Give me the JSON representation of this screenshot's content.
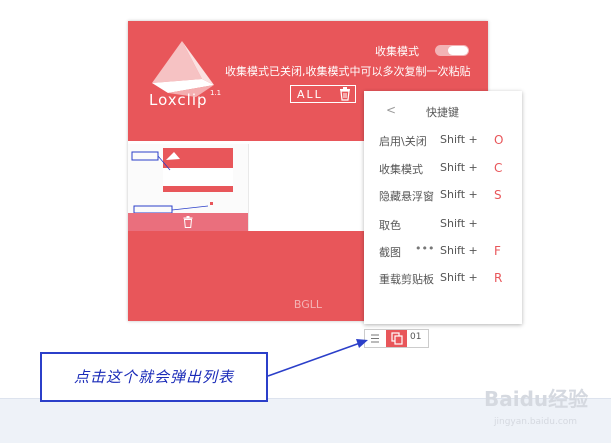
{
  "app": {
    "name": "Loxclip",
    "version": "1.1",
    "collect_mode_label": "收集模式",
    "status_text": "收集模式已关闭,收集模式中可以多次复制一次粘贴",
    "all_button_label": "ALL",
    "footer_brand": "BGLL"
  },
  "shortcuts_menu": {
    "back_symbol": "<",
    "title": "快捷键",
    "rows": [
      {
        "name": "启用\\关闭",
        "modifier": "Shift +",
        "key": "O"
      },
      {
        "name": "收集模式",
        "modifier": "Shift +",
        "key": "C"
      },
      {
        "name": "隐藏悬浮窗",
        "modifier": "Shift +",
        "key": "S"
      },
      {
        "name": "取色",
        "modifier": "Shift +",
        "key": ""
      },
      {
        "name": "截图",
        "modifier": "Shift +",
        "key": "F",
        "extra": "•••"
      },
      {
        "name": "重载剪贴板",
        "modifier": "Shift +",
        "key": "R"
      }
    ]
  },
  "bottom_tab": {
    "count": "01"
  },
  "annotation": {
    "text": "点击这个就会弹出列表"
  },
  "watermark": {
    "text": "Baidu经验",
    "url": "jingyan.baidu.com"
  },
  "colors": {
    "brand_red": "#e8565a",
    "annotation_blue": "#1a2bb8"
  }
}
